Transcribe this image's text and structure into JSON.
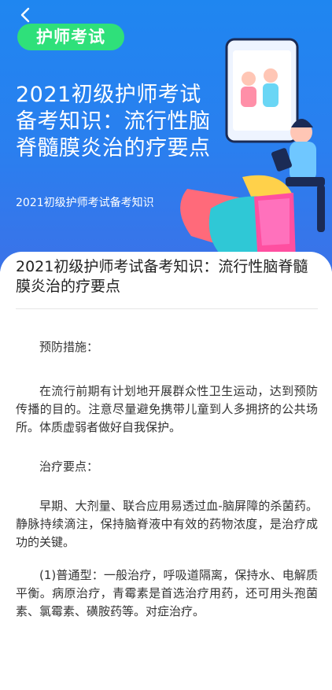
{
  "hero": {
    "tag": "护师考试",
    "title": "2021初级护师考试备考知识：流行性脑脊髓膜炎治的疗要点",
    "subtitle": "2021初级护师考试备考知识"
  },
  "article": {
    "title": "2021初级护师考试备考知识：流行性脑脊髓膜炎治的疗要点",
    "paragraphs": [
      "预防措施：",
      "在流行前期有计划地开展群众性卫生运动，达到预防传播的目的。注意尽量避免携带儿童到人多拥挤的公共场所。体质虚弱者做好自我保护。",
      "治疗要点：",
      "早期、大剂量、联合应用易透过血-脑屏障的杀菌药。静脉持续滴注，保持脑脊液中有效的药物浓度，是治疗成功的关键。",
      "(1)普通型：一般治疗，呼吸道隔离，保持水、电解质平衡。病原治疗，青霉素是首选治疗用药，还可用头孢菌素、氯霉素、磺胺药等。对症治疗。"
    ]
  },
  "icons": {
    "back": "chevron-left-icon"
  },
  "colors": {
    "header_blue": "#1f86f0",
    "tag_green": "#2fe07a"
  }
}
